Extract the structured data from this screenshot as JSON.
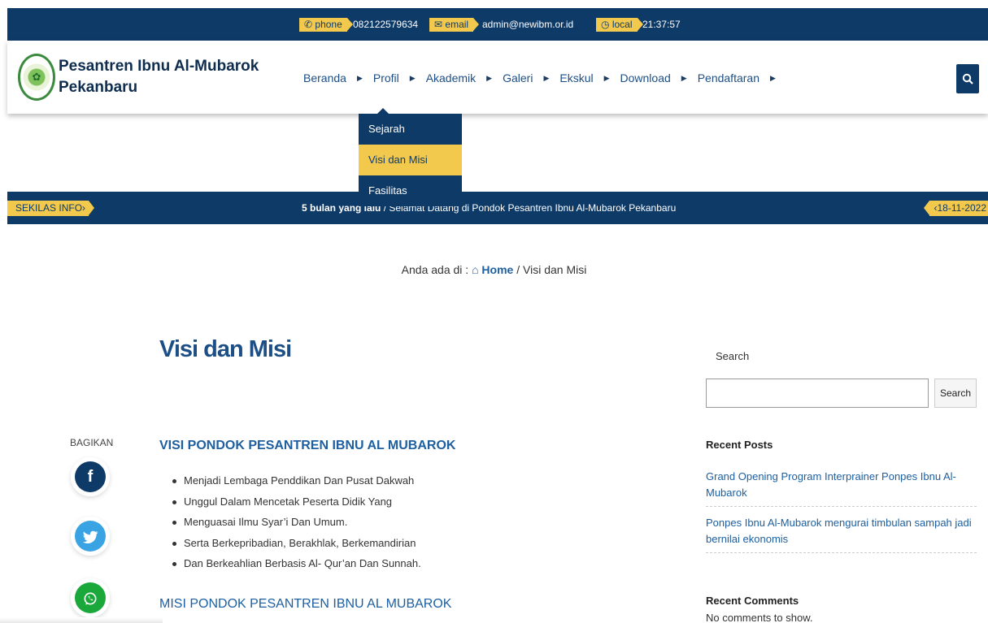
{
  "topbar": {
    "phone_tag": "phone",
    "phone_value": "082122579634",
    "email_tag": "email",
    "email_value": "admin@newibm.or.id",
    "local_tag": "local",
    "local_value": "21:37:57"
  },
  "site": {
    "title_line1": "Pesantren Ibnu Al-Mubarok",
    "title_line2": "Pekanbaru"
  },
  "nav": {
    "items": [
      {
        "label": "Beranda"
      },
      {
        "label": "Profil"
      },
      {
        "label": "Akademik"
      },
      {
        "label": "Galeri"
      },
      {
        "label": "Ekskul"
      },
      {
        "label": "Download"
      },
      {
        "label": "Pendaftaran"
      }
    ],
    "dropdown": [
      {
        "label": "Sejarah"
      },
      {
        "label": "Visi dan Misi"
      },
      {
        "label": "Fasilitas"
      }
    ]
  },
  "ticker": {
    "tag": "SEKILAS INFO",
    "time": "5 bulan yang lalu",
    "text": " / Selamat Datang di Pondok Pesantren Ibnu Al-Mubarok Pekanbaru",
    "date": "18-11-2022"
  },
  "breadcrumb": {
    "prefix": "Anda ada di : ",
    "home": "Home",
    "current": " / Visi dan Misi"
  },
  "main": {
    "title": "Visi dan Misi",
    "share_label": "BAGIKAN",
    "visi_heading": "VISI PONDOK PESANTREN IBNU AL MUBAROK",
    "visi_items": [
      "Menjadi Lembaga Penddikan Dan Pusat Dakwah",
      "Unggul Dalam Mencetak Peserta Didik Yang",
      "Menguasai Ilmu Syar’i Dan Umum.",
      "Serta Berkepribadian, Berakhlak, Berkemandirian",
      "Dan Berkeahlian Berbasis Al- Qur’an Dan Sunnah."
    ],
    "misi_heading": "MISI PONDOK PESANTREN IBNU AL MUBAROK"
  },
  "sidebar": {
    "search_label": "Search",
    "search_value": "",
    "search_button": "Search",
    "recent_posts_title": "Recent Posts",
    "recent_posts": [
      "Grand Opening Program Interprainer Ponpes Ibnu Al-Mubarok",
      "Ponpes Ibnu Al-Mubarok mengurai timbulan sampah jadi bernilai ekonomis"
    ],
    "recent_comments_title": "Recent Comments",
    "no_comments": "No comments to show."
  },
  "icons": {
    "phone": "phone-icon",
    "email": "envelope-icon",
    "local": "clock-icon",
    "search": "search-icon",
    "home": "home-icon",
    "facebook": "facebook-icon",
    "twitter": "twitter-icon",
    "whatsapp": "whatsapp-icon"
  },
  "colors": {
    "navy": "#0e3a68",
    "accent": "#f2c94c",
    "link": "#1d5fa0",
    "facebook": "#0e3a68",
    "twitter": "#3aa3e3",
    "whatsapp": "#1aa83a"
  }
}
